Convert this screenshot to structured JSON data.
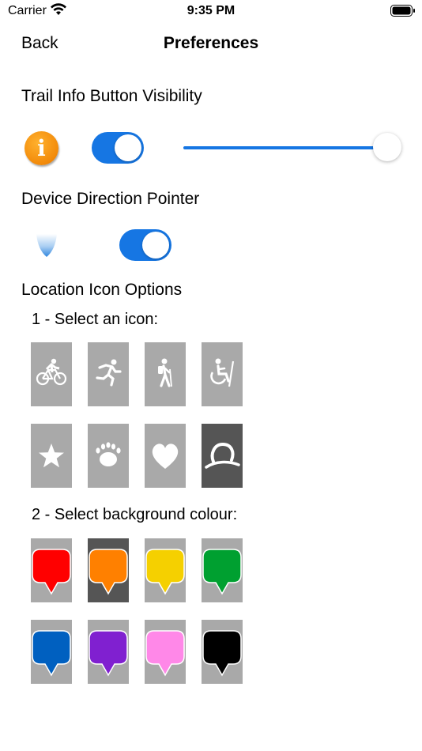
{
  "status_bar": {
    "carrier": "Carrier",
    "time": "9:35 PM"
  },
  "nav": {
    "back_label": "Back",
    "title": "Preferences"
  },
  "trail_info": {
    "title": "Trail Info Button Visibility",
    "icon_glyph": "i",
    "toggle_on": true,
    "slider_value": 1.0
  },
  "device_direction": {
    "title": "Device Direction Pointer",
    "toggle_on": true
  },
  "location_icons": {
    "title": "Location Icon Options",
    "step1_label": "1 - Select an icon:",
    "step2_label": "2 - Select background colour:",
    "icons": [
      {
        "name": "bike-icon",
        "selected": false
      },
      {
        "name": "run-icon",
        "selected": false
      },
      {
        "name": "hike-icon",
        "selected": false
      },
      {
        "name": "wheelchair-icon",
        "selected": false
      },
      {
        "name": "star-icon",
        "selected": false
      },
      {
        "name": "paw-icon",
        "selected": false
      },
      {
        "name": "heart-icon",
        "selected": false
      },
      {
        "name": "logo-icon",
        "selected": true
      }
    ],
    "colors": [
      {
        "name": "red",
        "hex": "#ff0000",
        "selected": false
      },
      {
        "name": "orange",
        "hex": "#ff8000",
        "selected": true
      },
      {
        "name": "yellow",
        "hex": "#f5d000",
        "selected": false
      },
      {
        "name": "green",
        "hex": "#00a030",
        "selected": false
      },
      {
        "name": "blue",
        "hex": "#0060c0",
        "selected": false
      },
      {
        "name": "purple",
        "hex": "#8020d0",
        "selected": false
      },
      {
        "name": "pink",
        "hex": "#ff88e8",
        "selected": false
      },
      {
        "name": "black",
        "hex": "#000000",
        "selected": false
      }
    ]
  },
  "accent": "#1676e3"
}
